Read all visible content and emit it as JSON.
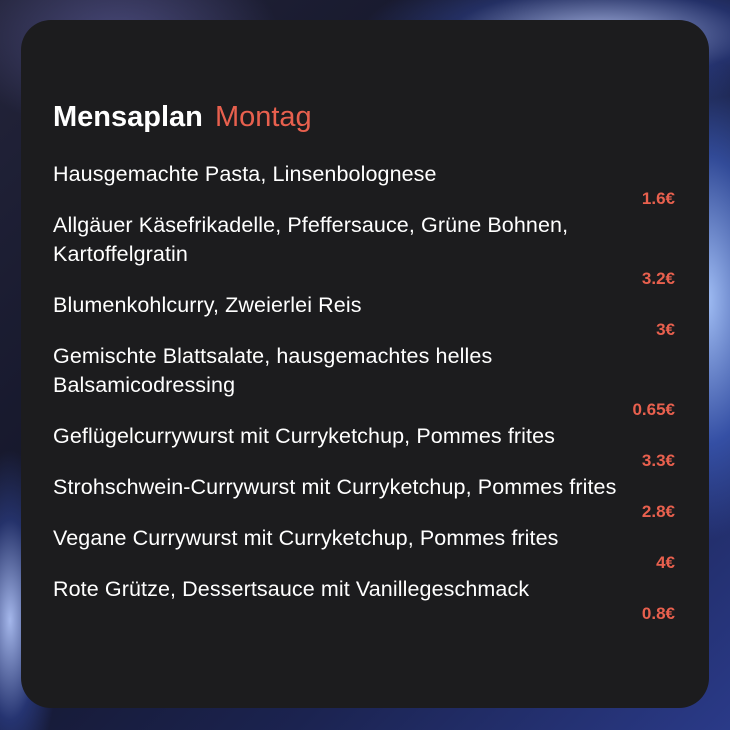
{
  "widget": {
    "title": "Mensaplan",
    "day": "Montag",
    "accent_color": "#e8604e",
    "items": [
      {
        "dish": "Hausgemachte Pasta, Linsenbolognese",
        "price": "1.6€"
      },
      {
        "dish": "Allgäuer Käsefrikadelle, Pfeffersauce, Grüne Bohnen, Kartoffelgratin",
        "price": "3.2€"
      },
      {
        "dish": "Blumenkohlcurry, Zweierlei Reis",
        "price": "3€"
      },
      {
        "dish": "Gemischte Blattsalate, hausgemachtes helles Balsamicodressing",
        "price": "0.65€"
      },
      {
        "dish": "Geflügelcurrywurst mit Curryketchup, Pommes frites",
        "price": "3.3€"
      },
      {
        "dish": "Strohschwein-Currywurst mit Curryketchup, Pommes frites",
        "price": "2.8€"
      },
      {
        "dish": "Vegane Currywurst mit Curryketchup, Pommes frites",
        "price": "4€"
      },
      {
        "dish": "Rote Grütze, Dessertsauce mit Vanillegeschmack",
        "price": "0.8€"
      }
    ]
  }
}
